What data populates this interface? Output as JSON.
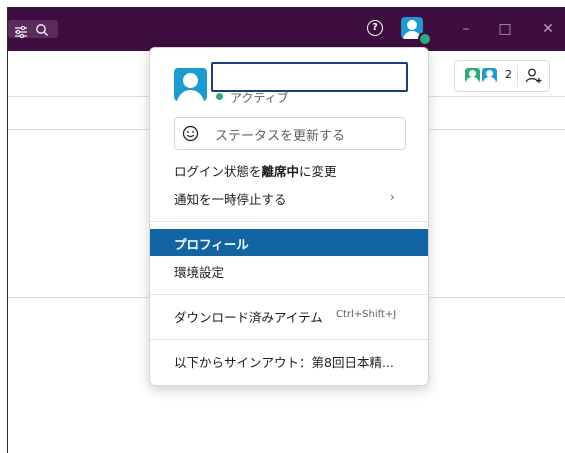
{
  "colors": {
    "titlebar_bg": "#3f0e40",
    "accent": "#1264a3",
    "online": "#2bac76",
    "avatar": "#1d9bd1"
  },
  "titlebar": {
    "icons": [
      "filter-icon",
      "search-icon",
      "help-icon",
      "user-avatar"
    ],
    "help_glyph": "?",
    "window_controls": {
      "minimize": "–",
      "maximize": "□",
      "close": "✕"
    }
  },
  "channel_header": {
    "member_count": "2"
  },
  "profile_menu": {
    "user_name": "",
    "status": "アクティブ",
    "status_input_placeholder": "ステータスを更新する",
    "presence_item": {
      "prefix": "ログイン状態を",
      "bold": "離席中",
      "suffix": "に変更"
    },
    "pause_notifications": "通知を一時停止する",
    "pause_chevron": "›",
    "profile": "プロフィール",
    "preferences": "環境設定",
    "downloads": "ダウンロード済みアイテム",
    "downloads_shortcut": "Ctrl+Shift+J",
    "sign_out": "以下からサインアウト：第8回日本精..."
  }
}
